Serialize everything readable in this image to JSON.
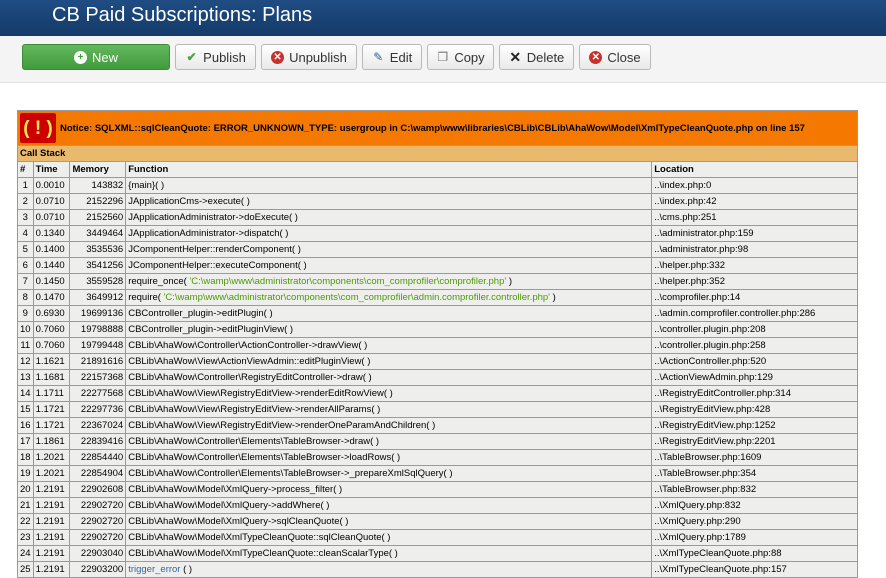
{
  "header": {
    "title": "CB Paid Subscriptions: Plans"
  },
  "toolbar": {
    "new": "New",
    "publish": "Publish",
    "unpublish": "Unpublish",
    "edit": "Edit",
    "copy": "Copy",
    "delete": "Delete",
    "close": "Close"
  },
  "error": {
    "icon_text": "( ! )",
    "notice": "Notice: SQLXML::sqlCleanQuote: ERROR_UNKNOWN_TYPE: usergroup in C:\\wamp\\www\\libraries\\CBLib\\CBLib\\AhaWow\\Model\\XmlTypeCleanQuote.php on line 157",
    "callstack_label": "Call Stack",
    "columns": {
      "num": "#",
      "time": "Time",
      "memory": "Memory",
      "function": "Function",
      "location": "Location"
    },
    "rows": [
      {
        "num": "1",
        "time": "0.0010",
        "memory": "143832",
        "func": "{main}( )",
        "arg": "",
        "loc": "..\\index.php:0"
      },
      {
        "num": "2",
        "time": "0.0710",
        "memory": "2152296",
        "func": "JApplicationCms->execute( )",
        "arg": "",
        "loc": "..\\index.php:42"
      },
      {
        "num": "3",
        "time": "0.0710",
        "memory": "2152560",
        "func": "JApplicationAdministrator->doExecute( )",
        "arg": "",
        "loc": "..\\cms.php:251"
      },
      {
        "num": "4",
        "time": "0.1340",
        "memory": "3449464",
        "func": "JApplicationAdministrator->dispatch( )",
        "arg": "",
        "loc": "..\\administrator.php:159"
      },
      {
        "num": "5",
        "time": "0.1400",
        "memory": "3535536",
        "func": "JComponentHelper::renderComponent( )",
        "arg": "",
        "loc": "..\\administrator.php:98"
      },
      {
        "num": "6",
        "time": "0.1440",
        "memory": "3541256",
        "func": "JComponentHelper::executeComponent( )",
        "arg": "",
        "loc": "..\\helper.php:332"
      },
      {
        "num": "7",
        "time": "0.1450",
        "memory": "3559528",
        "func": "require_once( ",
        "arg": "'C:\\wamp\\www\\administrator\\components\\com_comprofiler\\comprofiler.php'",
        "end": " )",
        "loc": "..\\helper.php:352"
      },
      {
        "num": "8",
        "time": "0.1470",
        "memory": "3649912",
        "func": "require( ",
        "arg": "'C:\\wamp\\www\\administrator\\components\\com_comprofiler\\admin.comprofiler.controller.php'",
        "end": " )",
        "loc": "..\\comprofiler.php:14"
      },
      {
        "num": "9",
        "time": "0.6930",
        "memory": "19699136",
        "func": "CBController_plugin->editPlugin( )",
        "arg": "",
        "loc": "..\\admin.comprofiler.controller.php:286"
      },
      {
        "num": "10",
        "time": "0.7060",
        "memory": "19798888",
        "func": "CBController_plugin->editPluginView( )",
        "arg": "",
        "loc": "..\\controller.plugin.php:208"
      },
      {
        "num": "11",
        "time": "0.7060",
        "memory": "19799448",
        "func": "CBLib\\AhaWow\\Controller\\ActionController->drawView( )",
        "arg": "",
        "loc": "..\\controller.plugin.php:258"
      },
      {
        "num": "12",
        "time": "1.1621",
        "memory": "21891616",
        "func": "CBLib\\AhaWow\\View\\ActionViewAdmin::editPluginView( )",
        "arg": "",
        "loc": "..\\ActionController.php:520"
      },
      {
        "num": "13",
        "time": "1.1681",
        "memory": "22157368",
        "func": "CBLib\\AhaWow\\Controller\\RegistryEditController->draw( )",
        "arg": "",
        "loc": "..\\ActionViewAdmin.php:129"
      },
      {
        "num": "14",
        "time": "1.1711",
        "memory": "22277568",
        "func": "CBLib\\AhaWow\\View\\RegistryEditView->renderEditRowView( )",
        "arg": "",
        "loc": "..\\RegistryEditController.php:314"
      },
      {
        "num": "15",
        "time": "1.1721",
        "memory": "22297736",
        "func": "CBLib\\AhaWow\\View\\RegistryEditView->renderAllParams( )",
        "arg": "",
        "loc": "..\\RegistryEditView.php:428"
      },
      {
        "num": "16",
        "time": "1.1721",
        "memory": "22367024",
        "func": "CBLib\\AhaWow\\View\\RegistryEditView->renderOneParamAndChildren( )",
        "arg": "",
        "loc": "..\\RegistryEditView.php:1252"
      },
      {
        "num": "17",
        "time": "1.1861",
        "memory": "22839416",
        "func": "CBLib\\AhaWow\\Controller\\Elements\\TableBrowser->draw( )",
        "arg": "",
        "loc": "..\\RegistryEditView.php:2201"
      },
      {
        "num": "18",
        "time": "1.2021",
        "memory": "22854440",
        "func": "CBLib\\AhaWow\\Controller\\Elements\\TableBrowser->loadRows( )",
        "arg": "",
        "loc": "..\\TableBrowser.php:1609"
      },
      {
        "num": "19",
        "time": "1.2021",
        "memory": "22854904",
        "func": "CBLib\\AhaWow\\Controller\\Elements\\TableBrowser->_prepareXmlSqlQuery( )",
        "arg": "",
        "loc": "..\\TableBrowser.php:354"
      },
      {
        "num": "20",
        "time": "1.2191",
        "memory": "22902608",
        "func": "CBLib\\AhaWow\\Model\\XmlQuery->process_filter( )",
        "arg": "",
        "loc": "..\\TableBrowser.php:832"
      },
      {
        "num": "21",
        "time": "1.2191",
        "memory": "22902720",
        "func": "CBLib\\AhaWow\\Model\\XmlQuery->addWhere( )",
        "arg": "",
        "loc": "..\\XmlQuery.php:832"
      },
      {
        "num": "22",
        "time": "1.2191",
        "memory": "22902720",
        "func": "CBLib\\AhaWow\\Model\\XmlQuery->sqlCleanQuote( )",
        "arg": "",
        "loc": "..\\XmlQuery.php:290"
      },
      {
        "num": "23",
        "time": "1.2191",
        "memory": "22902720",
        "func": "CBLib\\AhaWow\\Model\\XmlTypeCleanQuote::sqlCleanQuote( )",
        "arg": "",
        "loc": "..\\XmlQuery.php:1789"
      },
      {
        "num": "24",
        "time": "1.2191",
        "memory": "22903040",
        "func": "CBLib\\AhaWow\\Model\\XmlTypeCleanQuote::cleanScalarType( )",
        "arg": "",
        "loc": "..\\XmlTypeCleanQuote.php:88"
      },
      {
        "num": "25",
        "time": "1.2191",
        "memory": "22903200",
        "func": "",
        "link": "trigger_error",
        "end": " ( )",
        "loc": "..\\XmlTypeCleanQuote.php:157"
      }
    ]
  }
}
